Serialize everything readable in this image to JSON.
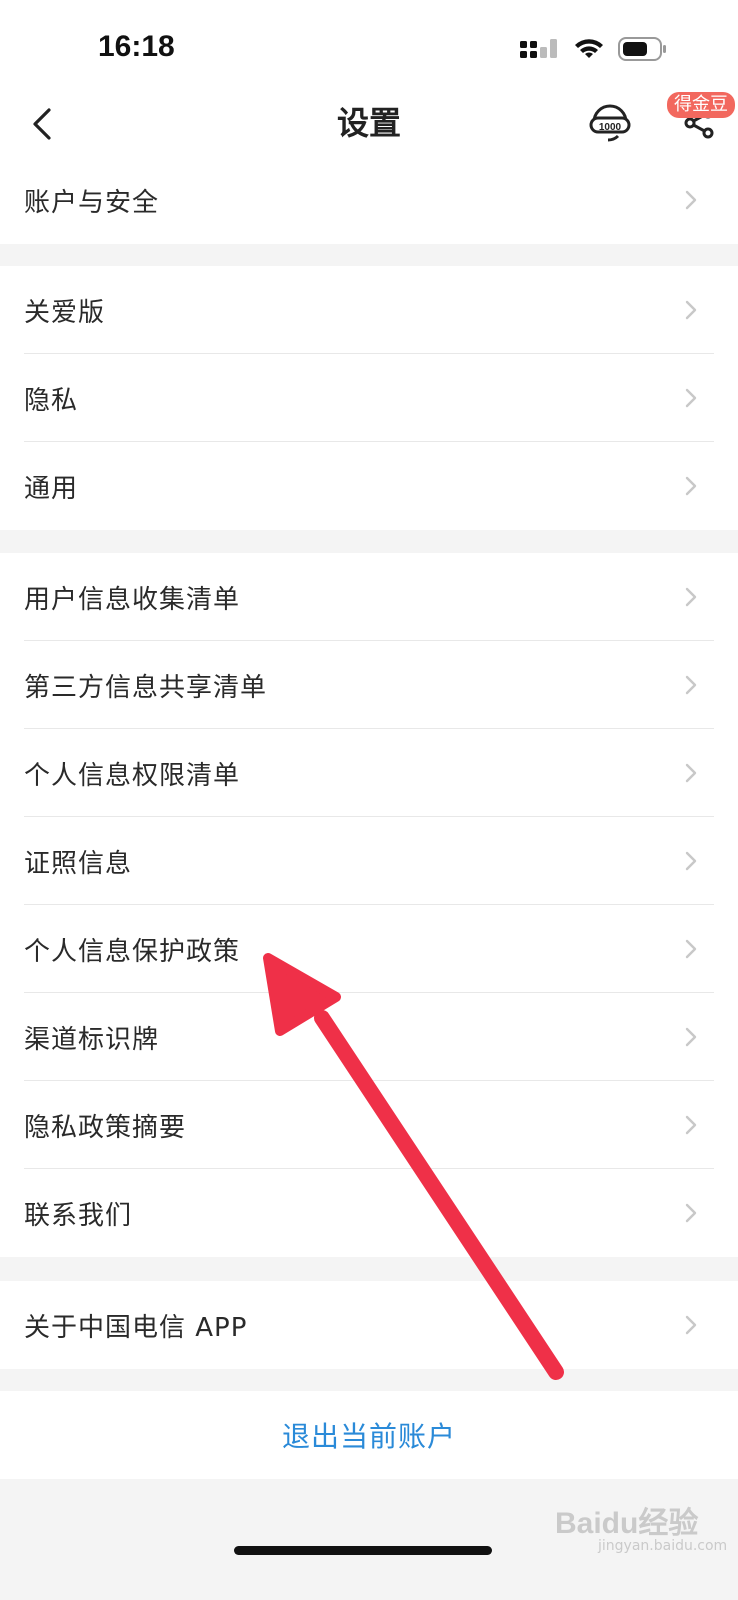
{
  "status_bar": {
    "time": "16:18"
  },
  "nav": {
    "title": "设置",
    "badge": "得金豆",
    "service_icon": "customer-service-10000-icon",
    "share_icon": "share-icon"
  },
  "groups": [
    {
      "items": [
        {
          "label": "账户与安全"
        }
      ]
    },
    {
      "items": [
        {
          "label": "关爱版"
        },
        {
          "label": "隐私"
        },
        {
          "label": "通用"
        }
      ]
    },
    {
      "items": [
        {
          "label": "用户信息收集清单"
        },
        {
          "label": "第三方信息共享清单"
        },
        {
          "label": "个人信息权限清单"
        },
        {
          "label": "证照信息"
        },
        {
          "label": "个人信息保护政策"
        },
        {
          "label": "渠道标识牌"
        },
        {
          "label": "隐私政策摘要"
        },
        {
          "label": "联系我们"
        }
      ]
    },
    {
      "items": [
        {
          "label": "关于中国电信 APP"
        }
      ]
    }
  ],
  "logout_label": "退出当前账户",
  "watermark": {
    "text": "Baidu经验",
    "sub": "jingyan.baidu.com"
  },
  "colors": {
    "background": "#f4f4f4",
    "link": "#2a8ad8",
    "badge": "#f2685e",
    "annotation_arrow": "#ef3048"
  }
}
